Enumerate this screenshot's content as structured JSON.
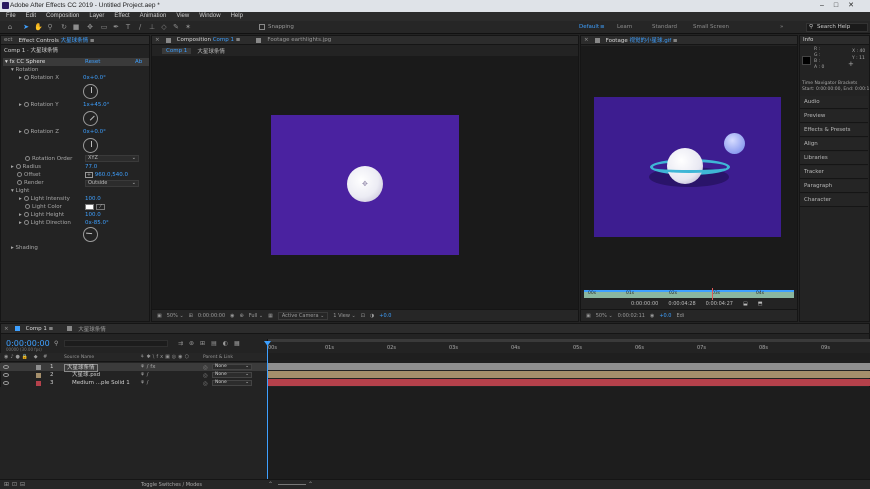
{
  "titlebar": {
    "title": "Adobe After Effects CC 2019 - Untitled Project.aep *"
  },
  "menu": [
    "File",
    "Edit",
    "Composition",
    "Layer",
    "Effect",
    "Animation",
    "View",
    "Window",
    "Help"
  ],
  "toolbar": {
    "snapping_label": "Snapping",
    "workspaces": [
      {
        "label": "Default",
        "active": true
      },
      {
        "label": "Learn",
        "active": false
      },
      {
        "label": "Standard",
        "active": false
      },
      {
        "label": "Small Screen",
        "active": false
      }
    ],
    "search_placeholder": "Search Help"
  },
  "effect_controls": {
    "tab_left": "ect",
    "tab_label": "Effect Controls",
    "tab_layer": "大星球条情",
    "header": "Comp 1 · 大星球条情",
    "effect_name": "CC Sphere",
    "reset": "Reset",
    "about": "Ab",
    "rotation": "Rotation",
    "rot_x_label": "Rotation X",
    "rot_x_val": "0x+0.0°",
    "rot_y_label": "Rotation Y",
    "rot_y_val": "1x+45.0°",
    "rot_z_label": "Rotation Z",
    "rot_z_val": "0x+0.0°",
    "rot_order_label": "Rotation Order",
    "rot_order_val": "XYZ",
    "radius_label": "Radius",
    "radius_val": "77.0",
    "offset_label": "Offset",
    "offset_val": "960.0,540.0",
    "render_label": "Render",
    "render_val": "Outside",
    "light": "Light",
    "li_label": "Light Intensity",
    "li_val": "100.0",
    "lc_label": "Light Color",
    "lh_label": "Light Height",
    "lh_val": "100.0",
    "ld_label": "Light Direction",
    "ld_val": "0x-85.0°",
    "shading": "Shading"
  },
  "comp_panel": {
    "tab_label": "Composition",
    "tab_name": "Comp 1",
    "footage_tab": "Footage earthlights.jpg",
    "crumb1": "Comp 1",
    "crumb2": "大星球条情",
    "zoom": "50%",
    "time": "0:00:00:00",
    "res": "Full",
    "camera": "Active Camera",
    "view": "1 View",
    "exposure": "+0.0"
  },
  "footage_panel": {
    "tab_label": "Footage",
    "tab_name": "视觉的小星球.gif",
    "ruler_labels": [
      "00s",
      "01s",
      "02s",
      "03s",
      "04s"
    ],
    "time_in": "0:00:00:00",
    "time_out": "0:00:04:28",
    "duration": "0:00:04:27",
    "zoom": "50%",
    "time": "0:00:02:11",
    "exposure": "+0.0",
    "edit": "Edi"
  },
  "info_panel": {
    "title": "Info",
    "r": "R :",
    "g": "G :",
    "b": "B :",
    "a": "A : 0",
    "x": "X : 40",
    "y": "Y : 11",
    "tnb_title": "Time Navigator Brackets",
    "tnb_text": "Start: 0:00:00:00, End: 0:00:1"
  },
  "right_panels": [
    "Audio",
    "Preview",
    "Effects & Presets",
    "Align",
    "Libraries",
    "Tracker",
    "Paragraph",
    "Character"
  ],
  "timeline": {
    "tab_comp": "Comp 1",
    "tab_layer": "大星球条情",
    "timecode": "0:00:00:00",
    "fps": "00000 (30.00 fps)",
    "col_source": "Source Name",
    "col_parent": "Parent & Link",
    "layers": [
      {
        "num": "1",
        "name": "大星球条情",
        "parent": "None",
        "color": "#8f8f8f",
        "selected": true
      },
      {
        "num": "2",
        "name": "大星球.psd",
        "parent": "None",
        "color": "#a58f6b",
        "selected": false
      },
      {
        "num": "3",
        "name": "Medium ...ple Solid 1",
        "parent": "None",
        "color": "#b5414b",
        "selected": false
      }
    ],
    "ruler": [
      "00s",
      "01s",
      "02s",
      "03s",
      "04s",
      "05s",
      "06s",
      "07s",
      "08s",
      "09s"
    ],
    "toggle_label": "Toggle Switches / Modes"
  },
  "colors": {
    "accent": "#3ea0ff",
    "comp_bg": "#4a22a0",
    "gif_bg": "#3d1d90"
  }
}
